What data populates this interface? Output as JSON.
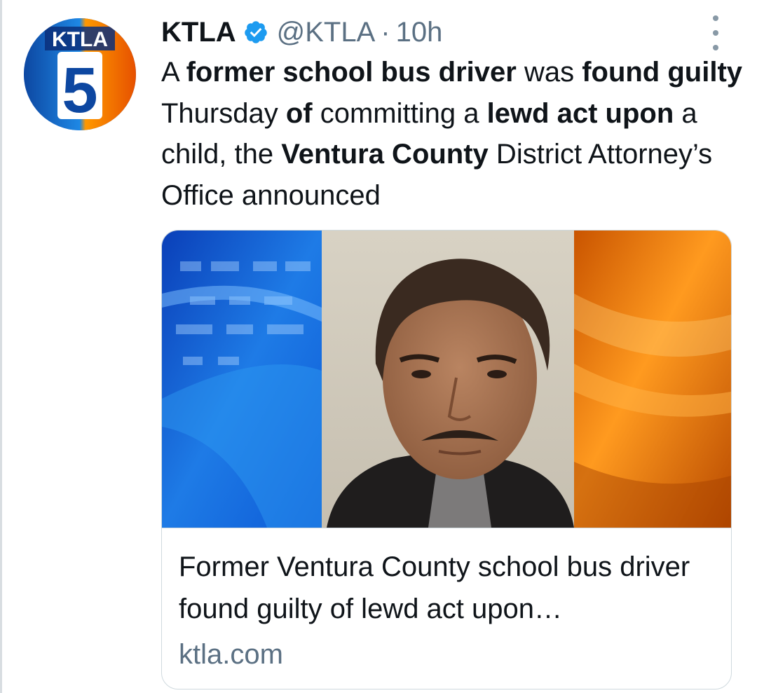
{
  "tweet": {
    "author": {
      "display_name": "KTLA",
      "handle": "@KTLA",
      "separator": "·",
      "time_ago": "10h",
      "verified": true,
      "avatar": {
        "logo_text": "KTLA",
        "logo_number": "5"
      }
    },
    "text_segments": [
      {
        "text": "A ",
        "bold": false
      },
      {
        "text": "former school bus driver",
        "bold": true
      },
      {
        "text": " was ",
        "bold": false
      },
      {
        "text": "found guilty",
        "bold": true
      },
      {
        "text": " Thursday ",
        "bold": false
      },
      {
        "text": "of",
        "bold": true
      },
      {
        "text": " committing a ",
        "bold": false
      },
      {
        "text": "lewd act upon",
        "bold": true
      },
      {
        "text": " a child, the ",
        "bold": false
      },
      {
        "text": "Ventura County",
        "bold": true
      },
      {
        "text": " District Attorney’s Office announced",
        "bold": false
      }
    ],
    "link_card": {
      "title": "Former Ventura County school bus driver found guilty of lewd act upon…",
      "domain": "ktla.com"
    }
  },
  "icons": {
    "verified": "verified-badge-icon",
    "more": "more-options-icon"
  },
  "colors": {
    "verified_blue": "#1d9bf0",
    "secondary_text": "#5b7083",
    "border": "#cfd9de",
    "brand_blue": "#1565c0",
    "brand_orange": "#f57c00"
  }
}
